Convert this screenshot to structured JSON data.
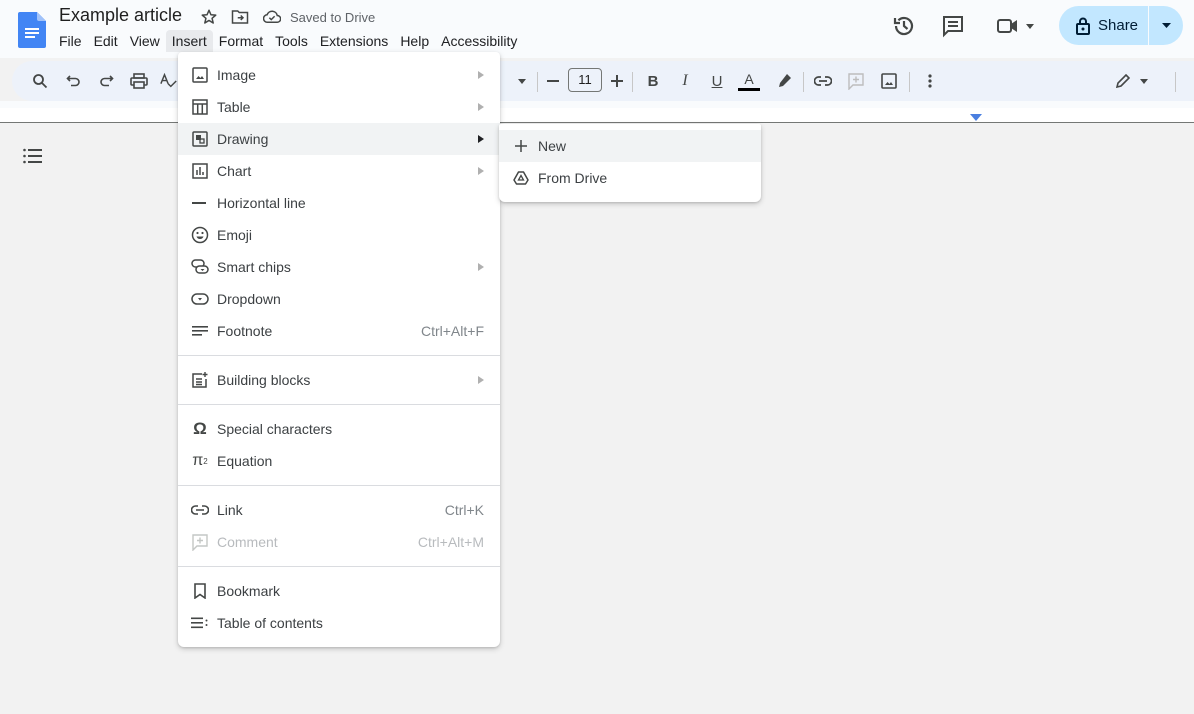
{
  "header": {
    "doc_title": "Example article",
    "save_status": "Saved to Drive",
    "icons": [
      "docs-logo-icon",
      "star-icon",
      "move-to-folder-icon",
      "cloud-saved-icon",
      "version-history-icon",
      "comments-icon",
      "meet-icon",
      "lock-icon"
    ],
    "share_label": "Share",
    "colors": {
      "share_bg": "#c2e7ff",
      "docs_blue": "#4285f4",
      "ruler_marker": "#4a7fe0"
    }
  },
  "menubar": {
    "items": [
      "File",
      "Edit",
      "View",
      "Insert",
      "Format",
      "Tools",
      "Extensions",
      "Help",
      "Accessibility"
    ],
    "active": "Insert"
  },
  "toolbar": {
    "font_size": "11",
    "icons": [
      "search-menus-icon",
      "undo-icon",
      "redo-icon",
      "print-icon",
      "spellcheck-icon",
      "font-dropdown-icon",
      "decrease-font-size-icon",
      "increase-font-size-icon",
      "bold-icon",
      "italic-icon",
      "underline-icon",
      "text-color-icon",
      "highlight-icon",
      "insert-link-icon",
      "add-comment-icon",
      "insert-image-icon",
      "more-options-icon",
      "editing-mode-icon"
    ]
  },
  "insert_menu": {
    "groups": [
      [
        {
          "label": "Image",
          "icon": "image-icon",
          "submenu": true
        },
        {
          "label": "Table",
          "icon": "table-icon",
          "submenu": true
        },
        {
          "label": "Drawing",
          "icon": "drawing-icon",
          "submenu": true,
          "highlighted": true
        },
        {
          "label": "Chart",
          "icon": "chart-icon",
          "submenu": true
        },
        {
          "label": "Horizontal line",
          "icon": "horizontal-line-icon"
        },
        {
          "label": "Emoji",
          "icon": "emoji-icon"
        },
        {
          "label": "Smart chips",
          "icon": "smart-chips-icon",
          "submenu": true
        },
        {
          "label": "Dropdown",
          "icon": "dropdown-icon"
        },
        {
          "label": "Footnote",
          "icon": "footnote-icon",
          "shortcut": "Ctrl+Alt+F"
        }
      ],
      [
        {
          "label": "Building blocks",
          "icon": "building-blocks-icon",
          "submenu": true
        }
      ],
      [
        {
          "label": "Special characters",
          "icon": "omega-icon"
        },
        {
          "label": "Equation",
          "icon": "pi-icon"
        }
      ],
      [
        {
          "label": "Link",
          "icon": "link-icon",
          "shortcut": "Ctrl+K"
        },
        {
          "label": "Comment",
          "icon": "comment-icon",
          "shortcut": "Ctrl+Alt+M",
          "disabled": true
        }
      ],
      [
        {
          "label": "Bookmark",
          "icon": "bookmark-icon"
        },
        {
          "label": "Table of contents",
          "icon": "table-of-contents-icon"
        }
      ]
    ]
  },
  "drawing_submenu": {
    "items": [
      {
        "label": "New",
        "icon": "plus-icon",
        "highlighted": true
      },
      {
        "label": "From Drive",
        "icon": "drive-icon"
      }
    ]
  },
  "sidebar": {
    "outline_icon": "document-outline-icon"
  }
}
